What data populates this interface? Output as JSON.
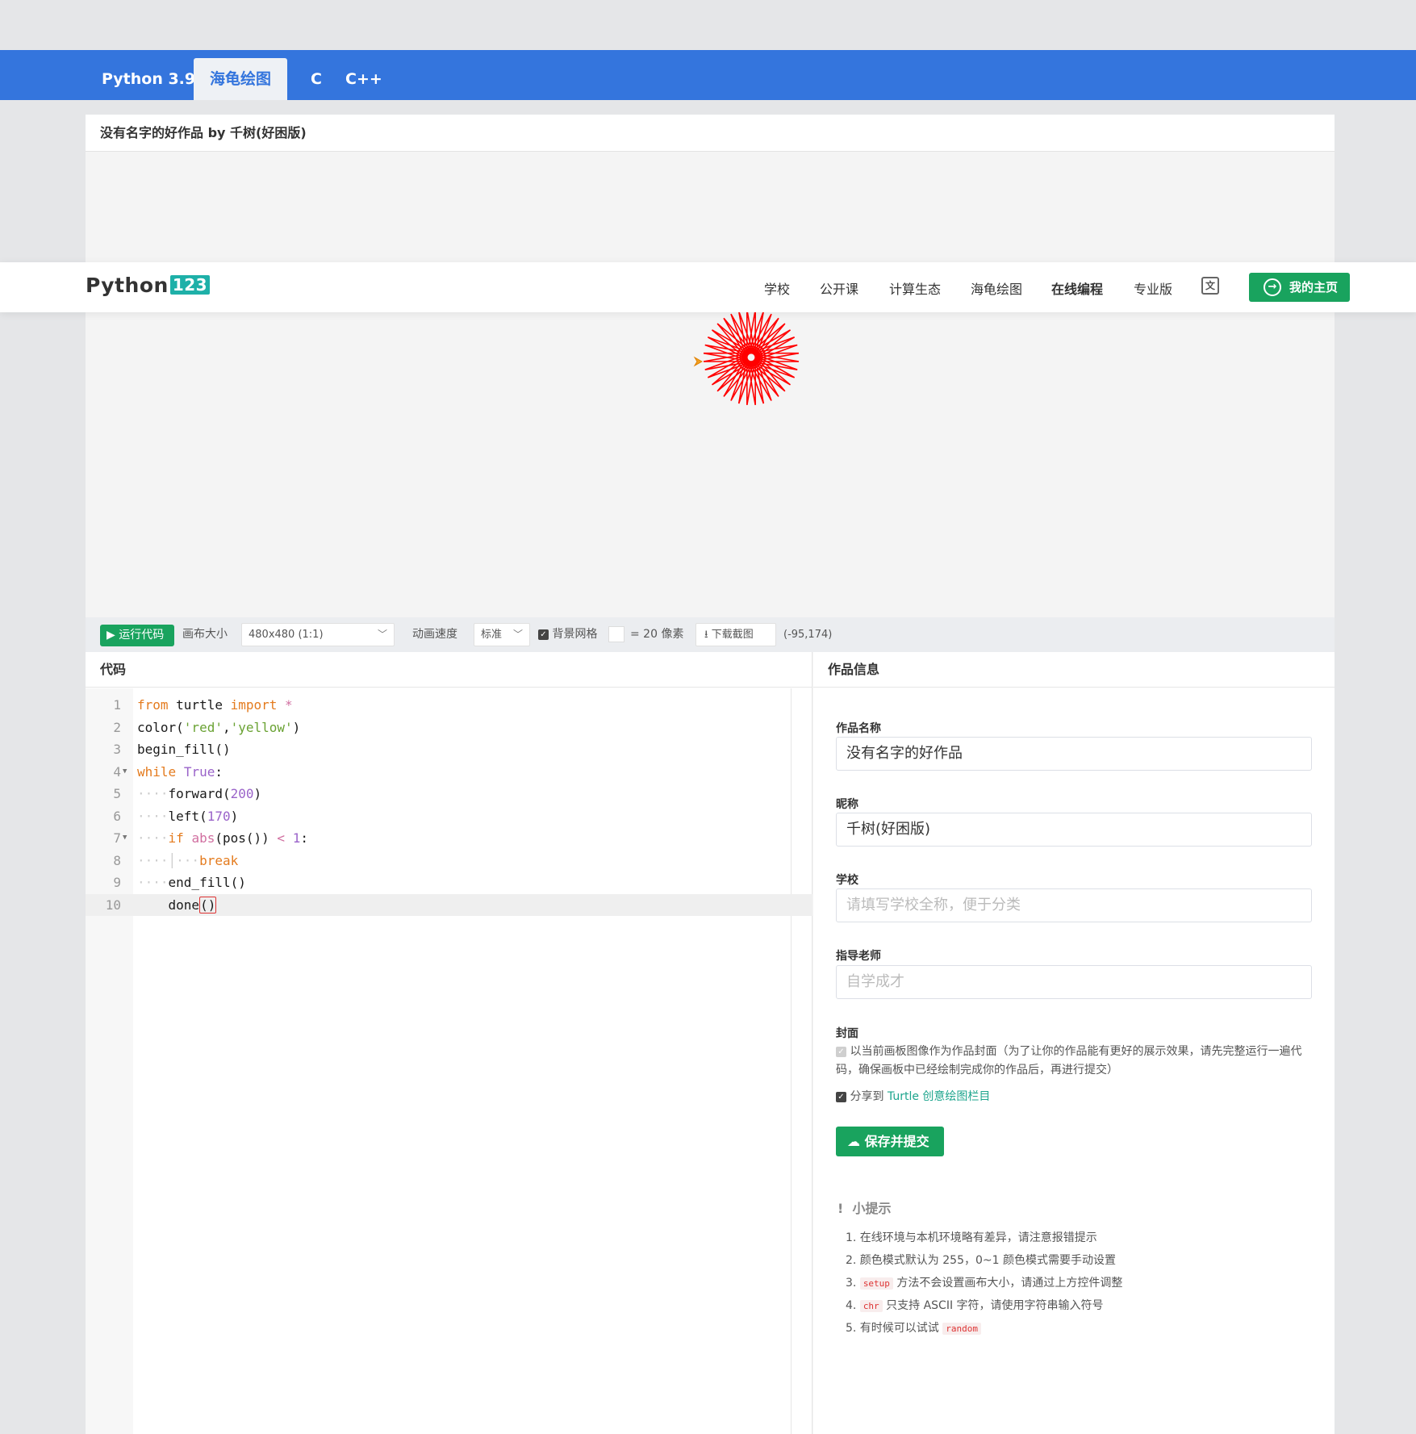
{
  "lang_tabs": [
    "Python 3.9",
    "海龟绘图",
    "C",
    "C++"
  ],
  "project_title": "没有名字的好作品 by 千树(好困版)",
  "navbar": {
    "logo_text": "Python",
    "logo_num": "123",
    "links": [
      "学校",
      "公开课",
      "计算生态",
      "海龟绘图",
      "在线编程",
      "专业版"
    ],
    "home_button": "我的主页"
  },
  "toolbar": {
    "run": "运行代码",
    "canvas_size_label": "画布大小",
    "canvas_size_value": "480x480 (1:1)",
    "speed_label": "动画速度",
    "speed_value": "标准",
    "grid_label": "背景网格",
    "grid_scale": "= 20 像素",
    "download": "下载截图",
    "coords": "(-95,174)"
  },
  "code_panel": {
    "title": "代码",
    "line_numbers": [
      "1",
      "2",
      "3",
      "4",
      "5",
      "6",
      "7",
      "8",
      "9",
      "10"
    ]
  },
  "info_panel": {
    "title": "作品信息",
    "name_label": "作品名称",
    "name_value": "没有名字的好作品",
    "nickname_label": "昵称",
    "nickname_value": "千树(好困版)",
    "school_label": "学校",
    "school_placeholder": "请填写学校全称，便于分类",
    "teacher_label": "指导老师",
    "teacher_placeholder": "自学成才",
    "cover_label": "封面",
    "cover_text": "以当前画板图像作为作品封面（为了让你的作品能有更好的展示效果，请先完整运行一遍代码，确保画板中已经绘制完成你的作品后，再进行提交）",
    "share_prefix": "分享到",
    "share_link": "Turtle 创意绘图栏目",
    "save_button": "保存并提交"
  },
  "tips": {
    "title": "小提示",
    "items": {
      "t1": "1. 在线环境与本机环境略有差异，请注意报错提示",
      "t2": "2. 颜色模式默认为 255，0~1 颜色模式需要手动设置",
      "t3_num": "3.",
      "t3_code": "setup",
      "t3_rest": "方法不会设置画布大小，请通过上方控件调整",
      "t4_num": "4.",
      "t4_code": "chr",
      "t4_rest": "只支持 ASCII 字符，请使用字符串输入符号",
      "t5_text": "5. 有时候可以试试",
      "t5_code": "random"
    }
  },
  "colors": {
    "lang_bar": "#3475dd",
    "primary_green": "#19a35e",
    "drawing": "#ff0000",
    "link": "#1ea58d"
  }
}
